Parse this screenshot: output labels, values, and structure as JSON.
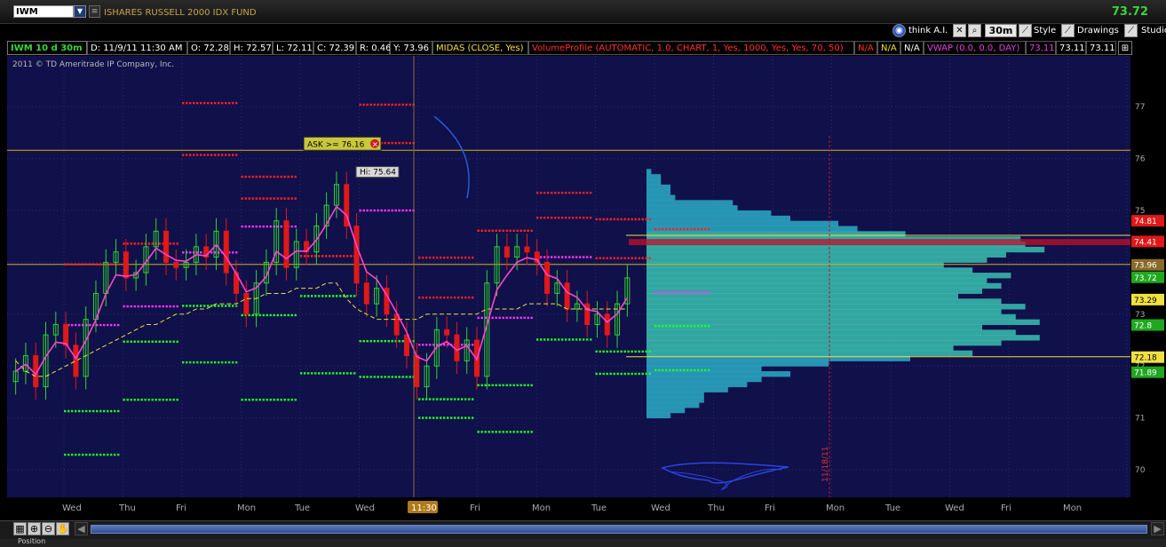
{
  "header": {
    "symbol": "IWM",
    "fund_name": "ISHARES RUSSELL 2000 IDX FUND",
    "last_price": "73.72"
  },
  "toolbar": {
    "think_ai": "think A.I.",
    "timeframe": "30m",
    "style": "Style",
    "drawings": "Drawings",
    "studies": "Studies"
  },
  "infobar": {
    "period": "IWM 10 d 30m",
    "date": "D: 11/9/11 11:30 AM",
    "open": "O: 72.28",
    "high": "H: 72.57",
    "low": "L: 72.11",
    "close": "C: 72.39",
    "range": "R: 0.46",
    "y": "Y: 73.96",
    "midas": "MIDAS (CLOSE, Yes)",
    "volume_profile": "VolumeProfile (AUTOMATIC, 1.0, CHART, 1, Yes, 1000, Yes, Yes, 70, 50)",
    "na1": "N/A",
    "na2": "N/A",
    "na3": "N/A",
    "vwap": "VWAP (0.0, 0.0, DAY)",
    "v1": "73.11",
    "v2": "73.11",
    "v3": "73.11"
  },
  "copyright": "2011 © TD Ameritrade IP Company, Inc.",
  "scrollbar_label": "Position",
  "colors": {
    "background": "#10104a",
    "up_candle": "#2ed62e",
    "down_candle": "#e01818",
    "price_line": "#ff44cc",
    "midas_line": "#f0e040",
    "volume_profile": "#2aa3c0",
    "value_area": "#39c0b0",
    "resistance_dots": "#ff2020",
    "support_dots": "#20ff20",
    "pivot_dots": "#ff33ff"
  },
  "chart_data": {
    "type": "candlestick",
    "title": "",
    "xlabel": "",
    "ylabel": "",
    "ylim": [
      69.6,
      77.4
    ],
    "y_ticks": [
      70,
      71,
      72,
      73,
      74,
      75,
      76,
      77
    ],
    "x_ticks": [
      "Wed",
      "Thu",
      "Fri",
      "Mon",
      "Tue",
      "Wed",
      "11:30",
      "Fri",
      "Mon",
      "Tue",
      "Wed",
      "Thu",
      "Fri",
      "Mon",
      "Tue",
      "Wed",
      "Fri",
      "Mon"
    ],
    "highlighted_x_tick": "11:30",
    "vertical_date_label": "11/18/11",
    "annotations": [
      {
        "text": "ASK >= 76.16",
        "price": 76.16
      },
      {
        "text": "Hi: 75.64",
        "price": 75.64
      }
    ],
    "price_markers": [
      {
        "value": "74.81",
        "bg": "#e01818",
        "fg": "#ffffff"
      },
      {
        "value": "74.41",
        "bg": "#e01818",
        "fg": "#ffffff"
      },
      {
        "value": "73.96",
        "bg": "#8a6a2a",
        "fg": "#ffffff"
      },
      {
        "value": "73.72",
        "bg": "#1fa81f",
        "fg": "#ffffff"
      },
      {
        "value": "73.29",
        "bg": "#f0e040",
        "fg": "#000000"
      },
      {
        "value": "72.8",
        "bg": "#1fa81f",
        "fg": "#ffffff"
      },
      {
        "value": "72.18",
        "bg": "#f0e040",
        "fg": "#000000"
      },
      {
        "value": "71.89",
        "bg": "#1fa81f",
        "fg": "#ffffff"
      }
    ],
    "horizontal_lines": [
      {
        "price": 76.16,
        "color": "#d4b020"
      },
      {
        "price": 73.96,
        "color": "#d4b020"
      },
      {
        "price": 74.52,
        "color": "#f0e040"
      },
      {
        "price": 72.18,
        "color": "#f0e040"
      }
    ],
    "value_area": {
      "low": 72.18,
      "high": 74.52,
      "band": [
        74.33,
        74.45
      ]
    },
    "volume_profile": [
      {
        "price": 71.0,
        "vol": 5
      },
      {
        "price": 71.1,
        "vol": 8
      },
      {
        "price": 71.2,
        "vol": 11
      },
      {
        "price": 71.3,
        "vol": 12
      },
      {
        "price": 71.4,
        "vol": 12
      },
      {
        "price": 71.5,
        "vol": 17
      },
      {
        "price": 71.6,
        "vol": 21
      },
      {
        "price": 71.7,
        "vol": 24
      },
      {
        "price": 71.8,
        "vol": 30
      },
      {
        "price": 71.9,
        "vol": 24
      },
      {
        "price": 72.0,
        "vol": 38
      },
      {
        "price": 72.1,
        "vol": 55
      },
      {
        "price": 72.2,
        "vol": 68
      },
      {
        "price": 72.3,
        "vol": 64
      },
      {
        "price": 72.4,
        "vol": 74
      },
      {
        "price": 72.5,
        "vol": 82
      },
      {
        "price": 72.6,
        "vol": 77
      },
      {
        "price": 72.7,
        "vol": 70
      },
      {
        "price": 72.8,
        "vol": 82
      },
      {
        "price": 72.9,
        "vol": 77
      },
      {
        "price": 73.0,
        "vol": 74
      },
      {
        "price": 73.1,
        "vol": 79
      },
      {
        "price": 73.2,
        "vol": 74
      },
      {
        "price": 73.3,
        "vol": 65
      },
      {
        "price": 73.4,
        "vol": 70
      },
      {
        "price": 73.5,
        "vol": 74
      },
      {
        "price": 73.6,
        "vol": 71
      },
      {
        "price": 73.7,
        "vol": 76
      },
      {
        "price": 73.8,
        "vol": 68
      },
      {
        "price": 73.9,
        "vol": 62
      },
      {
        "price": 74.0,
        "vol": 71
      },
      {
        "price": 74.1,
        "vol": 75
      },
      {
        "price": 74.2,
        "vol": 83
      },
      {
        "price": 74.3,
        "vol": 79
      },
      {
        "price": 74.4,
        "vol": 78
      },
      {
        "price": 74.5,
        "vol": 54
      },
      {
        "price": 74.6,
        "vol": 44
      },
      {
        "price": 74.7,
        "vol": 40
      },
      {
        "price": 74.8,
        "vol": 30
      },
      {
        "price": 74.9,
        "vol": 26
      },
      {
        "price": 75.0,
        "vol": 19
      },
      {
        "price": 75.1,
        "vol": 18
      },
      {
        "price": 75.2,
        "vol": 6
      },
      {
        "price": 75.3,
        "vol": 5
      },
      {
        "price": 75.4,
        "vol": 5
      },
      {
        "price": 75.5,
        "vol": 3
      },
      {
        "price": 75.6,
        "vol": 3
      },
      {
        "price": 75.7,
        "vol": 1
      }
    ],
    "volume_profile_max": 100,
    "dot_levels": [
      {
        "from": 0,
        "to": 1,
        "price": 73.96,
        "color": "#ff2020"
      },
      {
        "from": 0,
        "to": 1,
        "price": 72.79,
        "color": "#ff33ff"
      },
      {
        "from": 0,
        "to": 1,
        "price": 71.13,
        "color": "#20ff20"
      },
      {
        "from": 0,
        "to": 1,
        "price": 70.29,
        "color": "#20ff20"
      },
      {
        "from": 1,
        "to": 2,
        "price": 74.36,
        "color": "#ff2020"
      },
      {
        "from": 1,
        "to": 2,
        "price": 73.15,
        "color": "#ff33ff"
      },
      {
        "from": 1,
        "to": 2,
        "price": 72.47,
        "color": "#20ff20"
      },
      {
        "from": 1,
        "to": 2,
        "price": 71.35,
        "color": "#20ff20"
      },
      {
        "from": 2,
        "to": 3,
        "price": 77.07,
        "color": "#ff2020"
      },
      {
        "from": 2,
        "to": 3,
        "price": 76.07,
        "color": "#ff2020"
      },
      {
        "from": 2,
        "to": 3,
        "price": 74.19,
        "color": "#ff33ff"
      },
      {
        "from": 2,
        "to": 3,
        "price": 73.16,
        "color": "#20ff20"
      },
      {
        "from": 2,
        "to": 3,
        "price": 72.07,
        "color": "#20ff20"
      },
      {
        "from": 3,
        "to": 4,
        "price": 75.65,
        "color": "#ff2020"
      },
      {
        "from": 3,
        "to": 4,
        "price": 75.23,
        "color": "#ff2020"
      },
      {
        "from": 3,
        "to": 4,
        "price": 74.69,
        "color": "#ff33ff"
      },
      {
        "from": 3,
        "to": 4,
        "price": 72.98,
        "color": "#20ff20"
      },
      {
        "from": 3,
        "to": 4,
        "price": 71.35,
        "color": "#20ff20"
      },
      {
        "from": 4,
        "to": 5,
        "price": 74.12,
        "color": "#ff2020"
      },
      {
        "from": 4,
        "to": 5,
        "price": 73.35,
        "color": "#20ff20"
      },
      {
        "from": 4,
        "to": 5,
        "price": 71.86,
        "color": "#20ff20"
      },
      {
        "from": 5,
        "to": 6,
        "price": 77.04,
        "color": "#ff2020"
      },
      {
        "from": 5,
        "to": 6,
        "price": 76.3,
        "color": "#ff2020"
      },
      {
        "from": 5,
        "to": 6,
        "price": 75.0,
        "color": "#ff33ff"
      },
      {
        "from": 5,
        "to": 6,
        "price": 72.48,
        "color": "#20ff20"
      },
      {
        "from": 5,
        "to": 6,
        "price": 71.79,
        "color": "#20ff20"
      },
      {
        "from": 6,
        "to": 7,
        "price": 74.09,
        "color": "#ff2020"
      },
      {
        "from": 6,
        "to": 7,
        "price": 73.32,
        "color": "#ff2020"
      },
      {
        "from": 6,
        "to": 7,
        "price": 72.41,
        "color": "#ff33ff"
      },
      {
        "from": 6,
        "to": 7,
        "price": 71.36,
        "color": "#20ff20"
      },
      {
        "from": 6,
        "to": 7,
        "price": 71.0,
        "color": "#20ff20"
      },
      {
        "from": 7,
        "to": 8,
        "price": 74.61,
        "color": "#ff2020"
      },
      {
        "from": 7,
        "to": 8,
        "price": 72.93,
        "color": "#ff33ff"
      },
      {
        "from": 7,
        "to": 8,
        "price": 71.63,
        "color": "#20ff20"
      },
      {
        "from": 7,
        "to": 8,
        "price": 70.73,
        "color": "#20ff20"
      },
      {
        "from": 8,
        "to": 9,
        "price": 75.34,
        "color": "#ff2020"
      },
      {
        "from": 8,
        "to": 9,
        "price": 74.86,
        "color": "#ff2020"
      },
      {
        "from": 8,
        "to": 9,
        "price": 74.1,
        "color": "#ff33ff"
      },
      {
        "from": 8,
        "to": 9,
        "price": 72.51,
        "color": "#20ff20"
      },
      {
        "from": 9,
        "to": 10,
        "price": 74.83,
        "color": "#ff2020"
      },
      {
        "from": 9,
        "to": 10,
        "price": 74.08,
        "color": "#ff2020"
      },
      {
        "from": 9,
        "to": 10,
        "price": 72.28,
        "color": "#20ff20"
      },
      {
        "from": 9,
        "to": 10,
        "price": 71.85,
        "color": "#20ff20"
      },
      {
        "from": 10,
        "to": 11,
        "price": 74.64,
        "color": "#ff2020"
      },
      {
        "from": 10,
        "to": 11,
        "price": 73.42,
        "color": "#ff33ff"
      },
      {
        "from": 10,
        "to": 11,
        "price": 72.77,
        "color": "#20ff20"
      },
      {
        "from": 10,
        "to": 11,
        "price": 71.92,
        "color": "#20ff20"
      }
    ],
    "close_series": [
      71.9,
      72.2,
      71.6,
      72.6,
      72.8,
      72.4,
      71.8,
      72.9,
      73.4,
      74.0,
      74.2,
      73.7,
      73.8,
      74.3,
      74.6,
      74.0,
      73.9,
      74.0,
      74.3,
      74.1,
      74.6,
      73.8,
      73.4,
      73.0,
      73.6,
      74.0,
      74.8,
      73.9,
      74.4,
      74.2,
      74.7,
      75.1,
      75.5,
      74.7,
      73.6,
      73.2,
      73.5,
      73.0,
      72.6,
      72.2,
      71.6,
      72.0,
      72.7,
      72.6,
      72.1,
      72.5,
      71.8,
      73.6,
      74.3,
      74.1,
      74.3,
      74.2,
      74.0,
      73.4,
      73.6,
      73.1,
      73.2,
      72.8,
      73.0,
      72.6,
      73.2,
      73.7
    ],
    "midas_series": [
      72.1,
      71.9,
      71.8,
      71.8,
      71.9,
      72.0,
      72.1,
      72.2,
      72.3,
      72.4,
      72.5,
      72.6,
      72.7,
      72.8,
      72.8,
      72.9,
      73.0,
      73.0,
      73.1,
      73.1,
      73.2,
      73.2,
      73.2,
      73.3,
      73.3,
      73.4,
      73.4,
      73.4,
      73.5,
      73.5,
      73.5,
      73.6,
      73.6,
      73.3,
      73.1,
      73.0,
      72.9,
      72.9,
      72.9,
      72.9,
      72.9,
      73.0,
      73.0,
      73.0,
      73.0,
      73.0,
      73.0,
      73.1,
      73.1,
      73.1,
      73.1,
      73.2,
      73.2,
      73.2,
      73.2,
      73.1,
      73.1,
      73.1,
      73.1,
      73.1,
      73.1,
      73.1
    ]
  }
}
